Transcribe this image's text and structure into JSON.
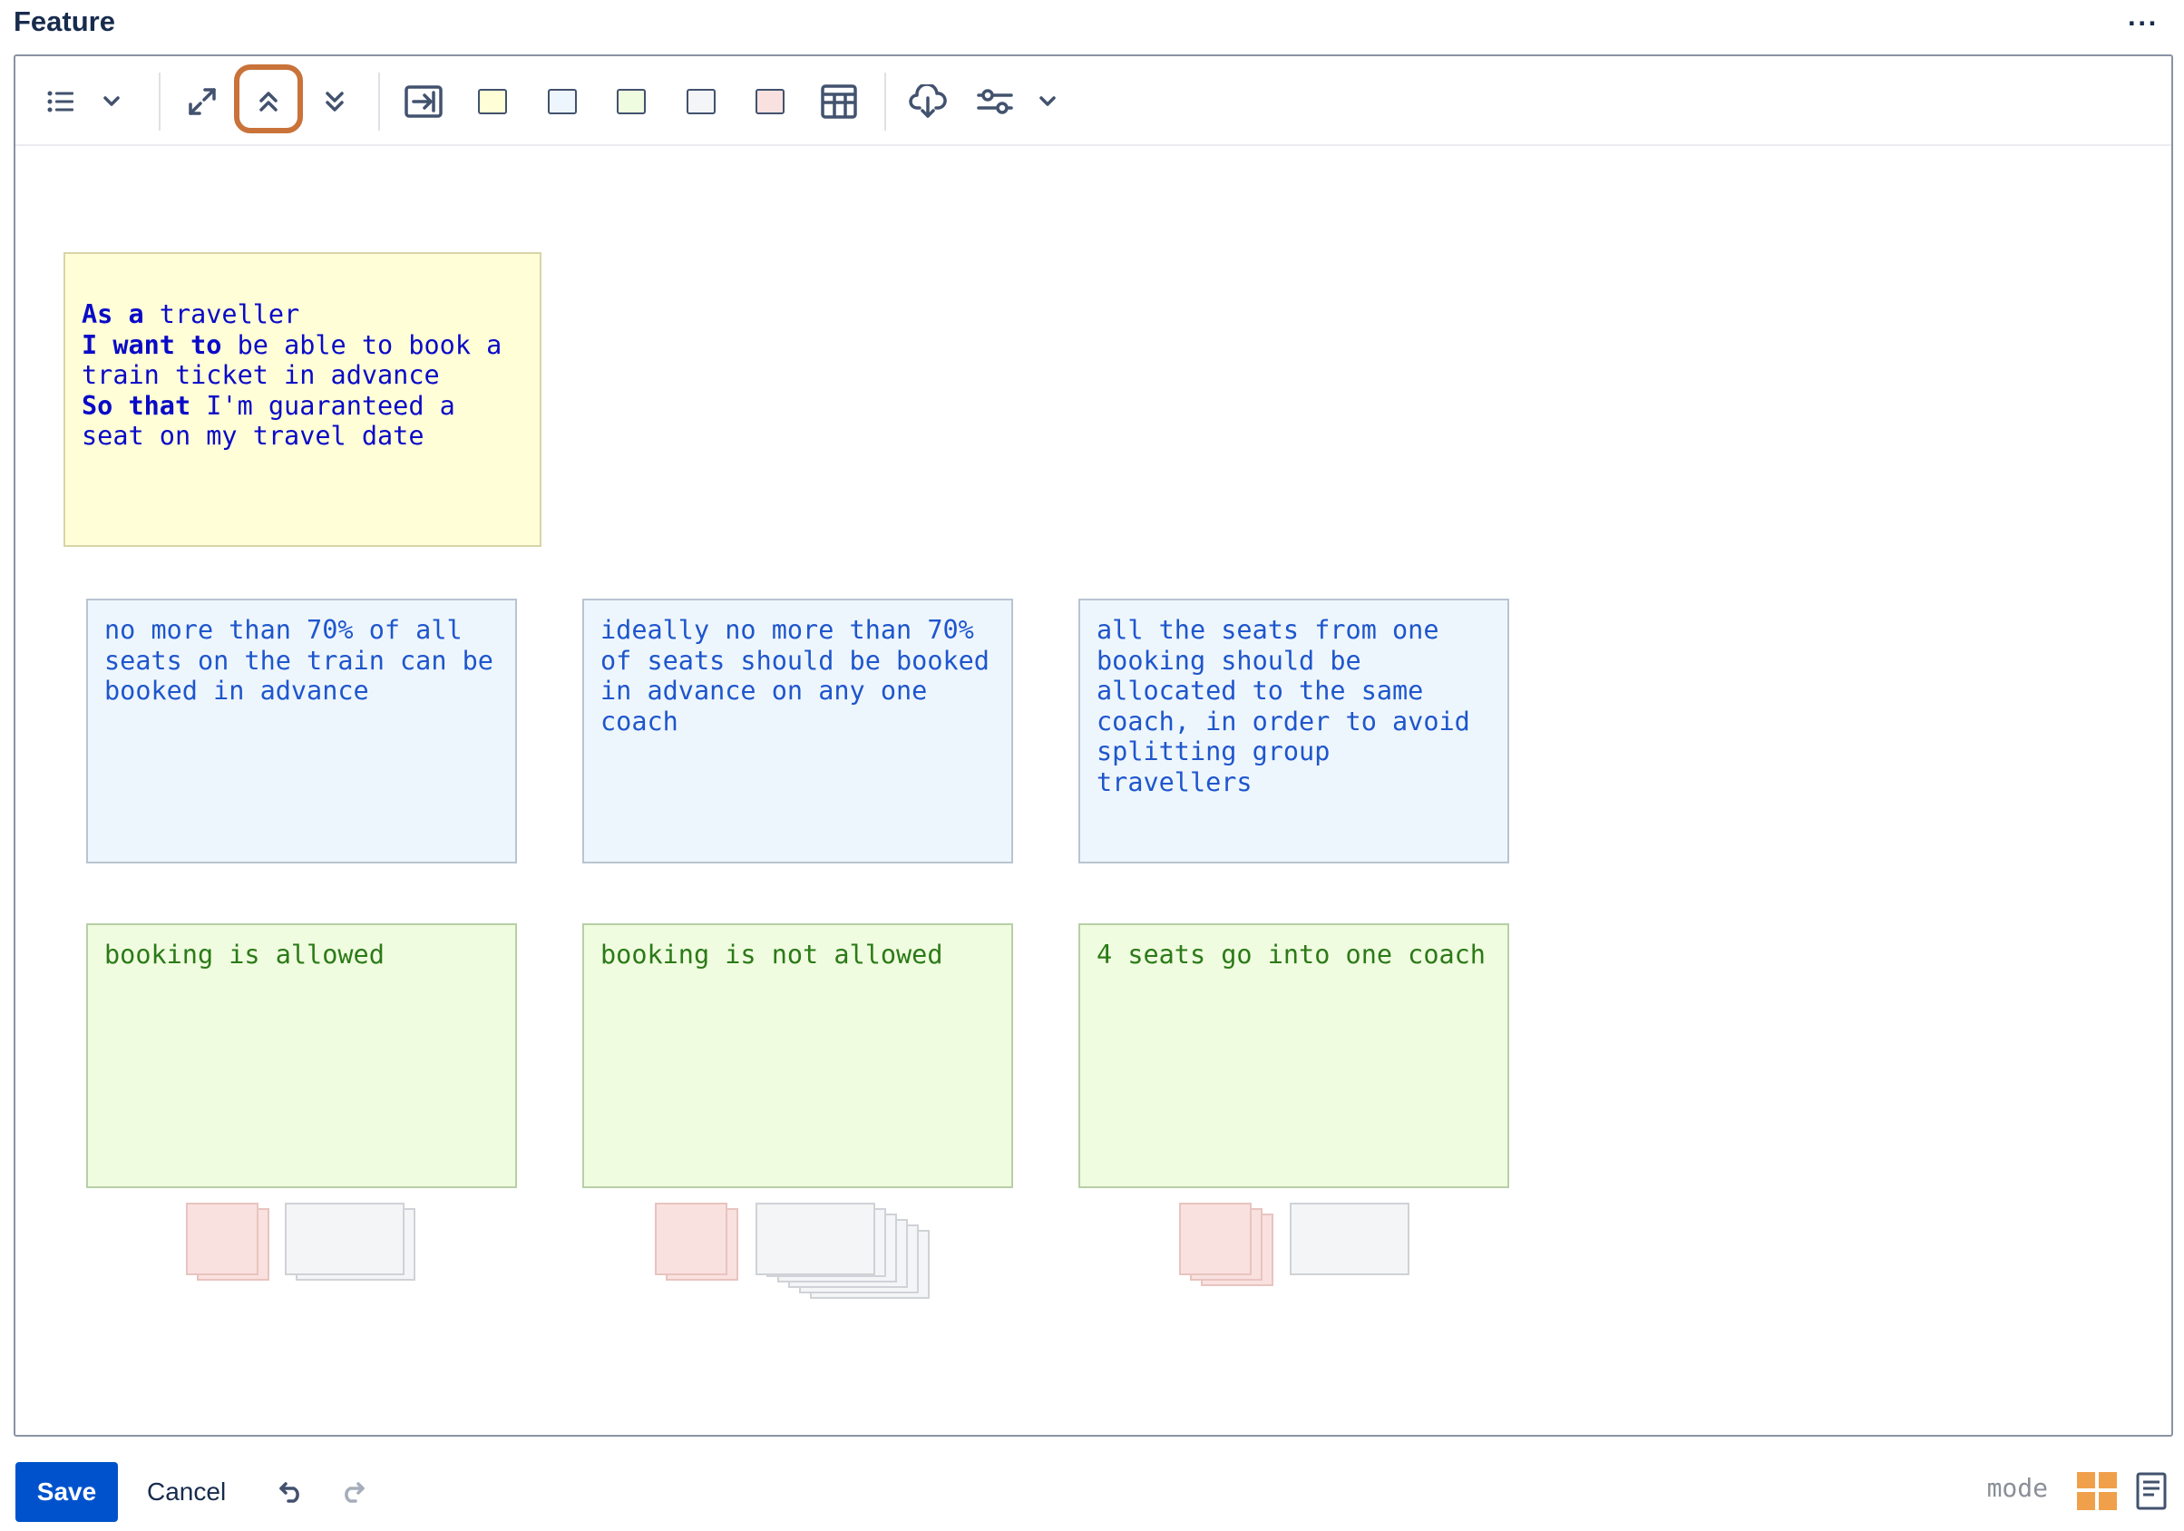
{
  "page": {
    "title": "Feature",
    "more_label": "···"
  },
  "toolbar": {
    "items": [
      {
        "name": "list-icon"
      },
      {
        "name": "chevron-down-icon"
      },
      {
        "name": "expand-icon"
      },
      {
        "name": "collapse-up-icon"
      },
      {
        "name": "collapse-down-icon"
      },
      {
        "name": "insert-card-icon"
      },
      {
        "name": "yellow-card-swatch",
        "color": "#fffed6"
      },
      {
        "name": "blue-card-swatch",
        "color": "#eef6fd"
      },
      {
        "name": "green-card-swatch",
        "color": "#f0fcdf"
      },
      {
        "name": "grey-card-swatch",
        "color": "#f4f5f7"
      },
      {
        "name": "pink-card-swatch",
        "color": "#f9e1df"
      },
      {
        "name": "table-icon"
      },
      {
        "name": "cloud-download-icon"
      },
      {
        "name": "settings-sliders-icon"
      },
      {
        "name": "chevron-down-icon"
      }
    ],
    "highlight_color": "#c9723a"
  },
  "story": {
    "line1_kw": "As a",
    "line1_rest": " traveller",
    "line2_kw": "I want to",
    "line2_rest": " be able to book a\ntrain ticket in advance",
    "line3_kw": "So that",
    "line3_rest": " I'm guaranteed a\nseat on my travel date"
  },
  "rules": [
    {
      "text": "no more than 70% of all seats on the train can be booked in advance"
    },
    {
      "text": "ideally no more than 70% of seats should be booked in advance on any one coach"
    },
    {
      "text": "all the seats from one booking should be allocated to the same coach, in order to avoid splitting group travellers"
    }
  ],
  "examples": [
    {
      "text": "booking is allowed"
    },
    {
      "text": "booking is not allowed"
    },
    {
      "text": "4 seats go into one coach"
    }
  ],
  "colors": {
    "story_bg": "#fffed6",
    "rule_bg": "#eef6fd",
    "example_bg": "#f0fcdf",
    "question_bg": "#f9e1df",
    "note_bg": "#f4f5f7",
    "save_blue": "#0052cc",
    "mode_icon": "#f0a04b"
  },
  "footer": {
    "save_label": "Save",
    "cancel_label": "Cancel",
    "mode_label": "mode"
  }
}
